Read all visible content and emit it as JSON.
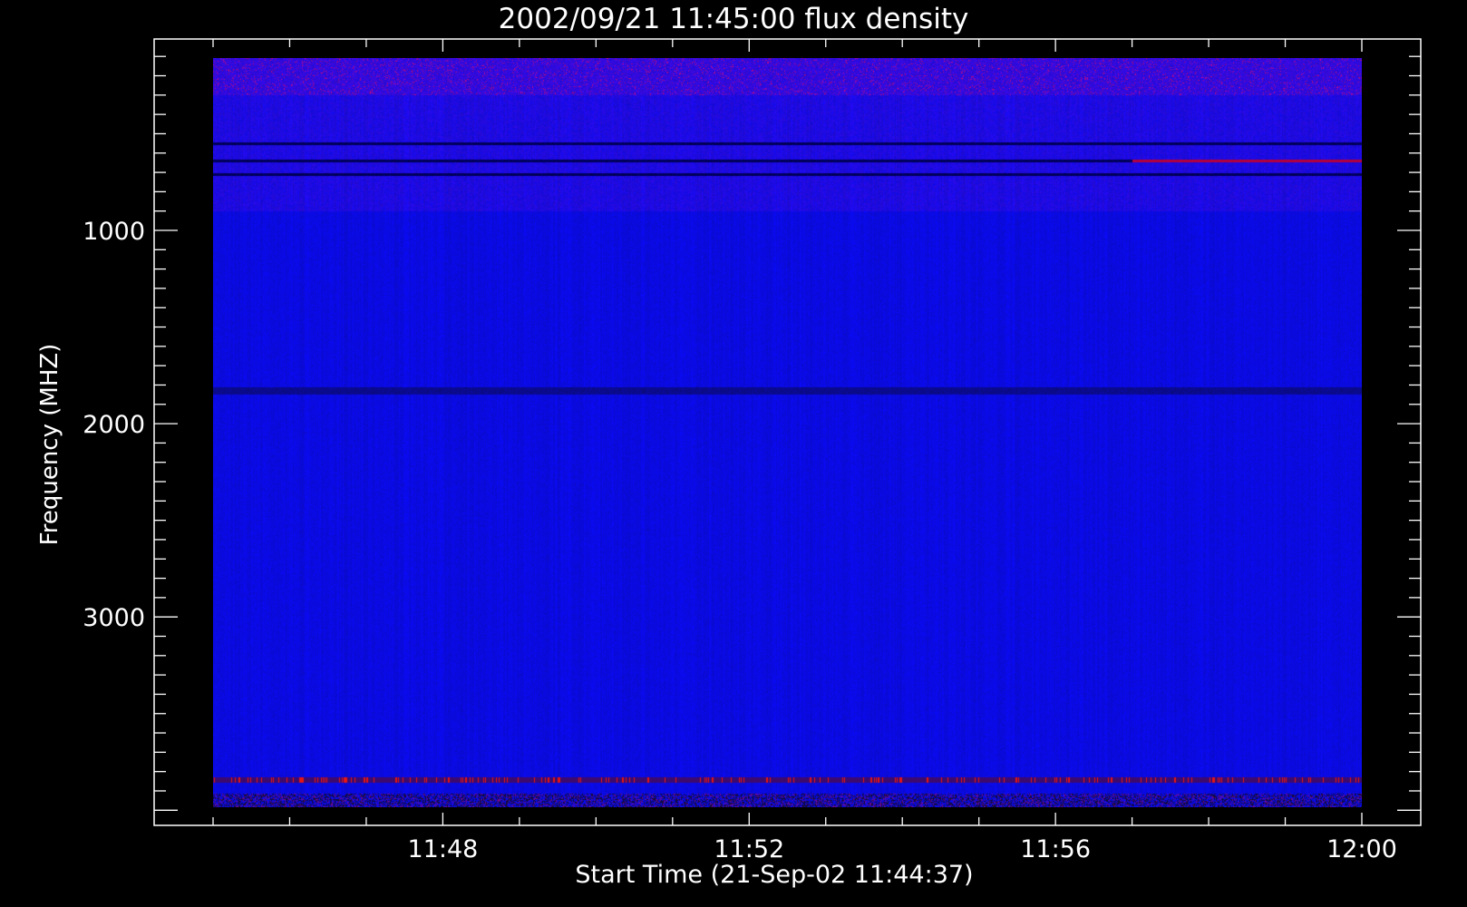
{
  "chart_data": {
    "type": "heatmap",
    "title": "2002/09/21 11:45:00 flux density",
    "xlabel": "Start Time (21-Sep-02 11:44:37)",
    "ylabel": "Frequency (MHZ)",
    "x_ticks": [
      {
        "label": "11:48",
        "minutes": 3
      },
      {
        "label": "11:52",
        "minutes": 7
      },
      {
        "label": "11:56",
        "minutes": 11
      },
      {
        "label": "12:00",
        "minutes": 15
      }
    ],
    "x_minor_step_minutes": 1,
    "x_range_minutes_after_1145": [
      -0.77,
      15.3
    ],
    "data_time_range_minutes_after_1145": [
      0,
      15
    ],
    "y_ticks": [
      {
        "label": "1000",
        "value": 1000
      },
      {
        "label": "2000",
        "value": 2000
      },
      {
        "label": "3000",
        "value": 3000
      }
    ],
    "y_minor_step": 100,
    "y_range": [
      12,
      4080
    ],
    "y_inverted": true,
    "data_freq_range": [
      109,
      3983
    ],
    "colormap": {
      "background": "#1010e8",
      "low": "#000060",
      "high": "#ff1010"
    },
    "features": [
      {
        "freq": 550,
        "kind": "dark-line"
      },
      {
        "freq": 640,
        "kind": "dark-line"
      },
      {
        "freq": 710,
        "kind": "dark-line"
      },
      {
        "freq": 1830,
        "kind": "dark-band"
      },
      {
        "freq": 3840,
        "kind": "red-burst-line"
      },
      {
        "freq": 3930,
        "kind": "noisy-band"
      }
    ]
  }
}
